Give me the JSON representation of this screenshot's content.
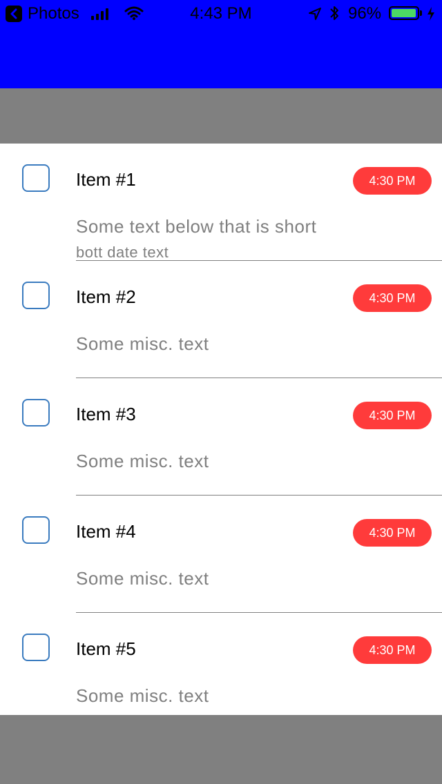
{
  "status_bar": {
    "back_app": "Photos",
    "time": "4:43 PM",
    "battery_percent": "96%",
    "battery_level": 0.96,
    "battery_color": "#4cd964"
  },
  "colors": {
    "top_bar": "#0000ff",
    "header": "#808080",
    "footer": "#808080",
    "badge": "#ff3b3b",
    "checkbox_border": "#3a7bbf"
  },
  "items": [
    {
      "title": "Item #1",
      "time": "4:30 PM",
      "subtitle": "Some text below that is short",
      "date_text": "bott date text",
      "checked": false
    },
    {
      "title": "Item #2",
      "time": "4:30 PM",
      "subtitle": "Some misc. text",
      "checked": false
    },
    {
      "title": "Item #3",
      "time": "4:30 PM",
      "subtitle": "Some misc. text",
      "checked": false
    },
    {
      "title": "Item #4",
      "time": "4:30 PM",
      "subtitle": "Some misc. text",
      "checked": false
    },
    {
      "title": "Item #5",
      "time": "4:30 PM",
      "subtitle": "Some misc. text",
      "checked": false
    }
  ]
}
